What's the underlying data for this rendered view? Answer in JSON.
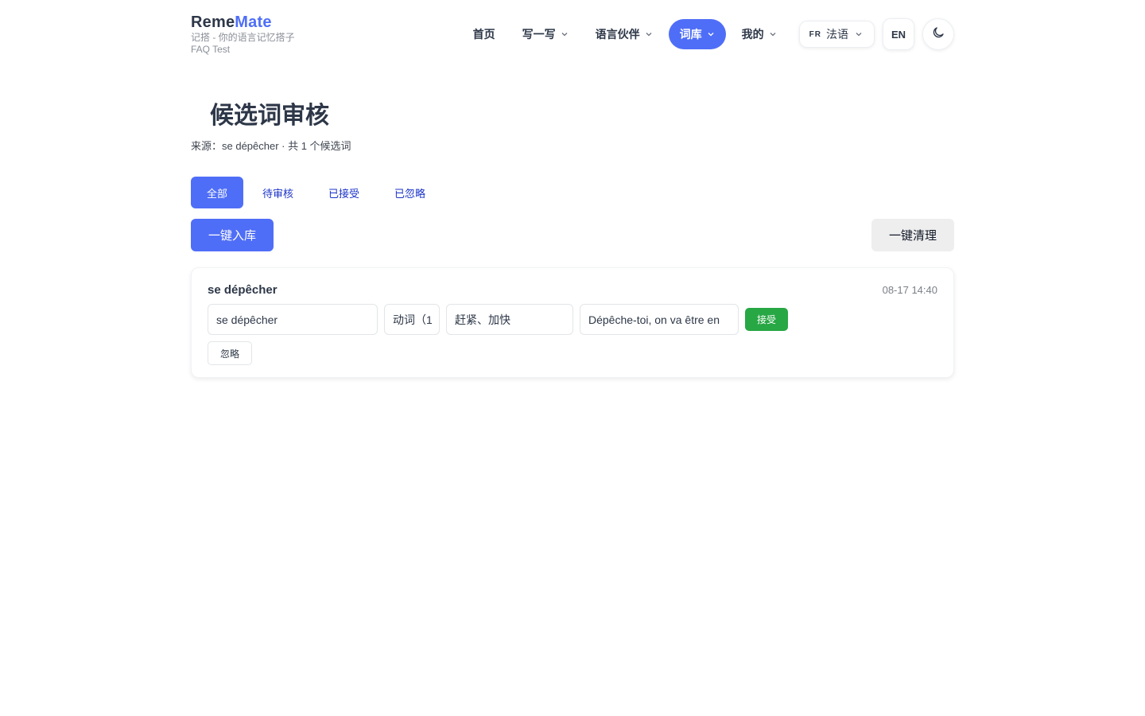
{
  "brand": {
    "name_part1": "Reme",
    "name_part2": "Mate",
    "tagline": "记搭 - 你的语言记忆搭子",
    "user": "FAQ Test"
  },
  "nav": {
    "home": "首页",
    "write": "写一写",
    "partner": "语言伙伴",
    "vocab": "词库",
    "mine": "我的",
    "active": "vocab"
  },
  "language_select": {
    "code": "FR",
    "label": "法语"
  },
  "ui_language": "EN",
  "theme_icon": "moon-icon",
  "page": {
    "title": "候选词审核",
    "subtitle": "来源：se dépêcher · 共 1 个候选词"
  },
  "tabs": [
    {
      "label": "全部",
      "active": true
    },
    {
      "label": "待审核",
      "active": false
    },
    {
      "label": "已接受",
      "active": false
    },
    {
      "label": "已忽略",
      "active": false
    }
  ],
  "actions": {
    "import_all": "一键入库",
    "clear_all": "一键清理"
  },
  "candidates": [
    {
      "word": "se dépêcher",
      "time": "08-17 14:40",
      "word_value": "se dépêcher",
      "pos_value": "动词（1",
      "meaning_value": "赶紧、加快",
      "example_value": "Dépêche-toi, on va être en",
      "accept_label": "接受",
      "ignore_label": "忽略"
    }
  ],
  "colors": {
    "accent": "#4f6ef7",
    "accept": "#28a745",
    "tab_link": "#1c34c9"
  }
}
